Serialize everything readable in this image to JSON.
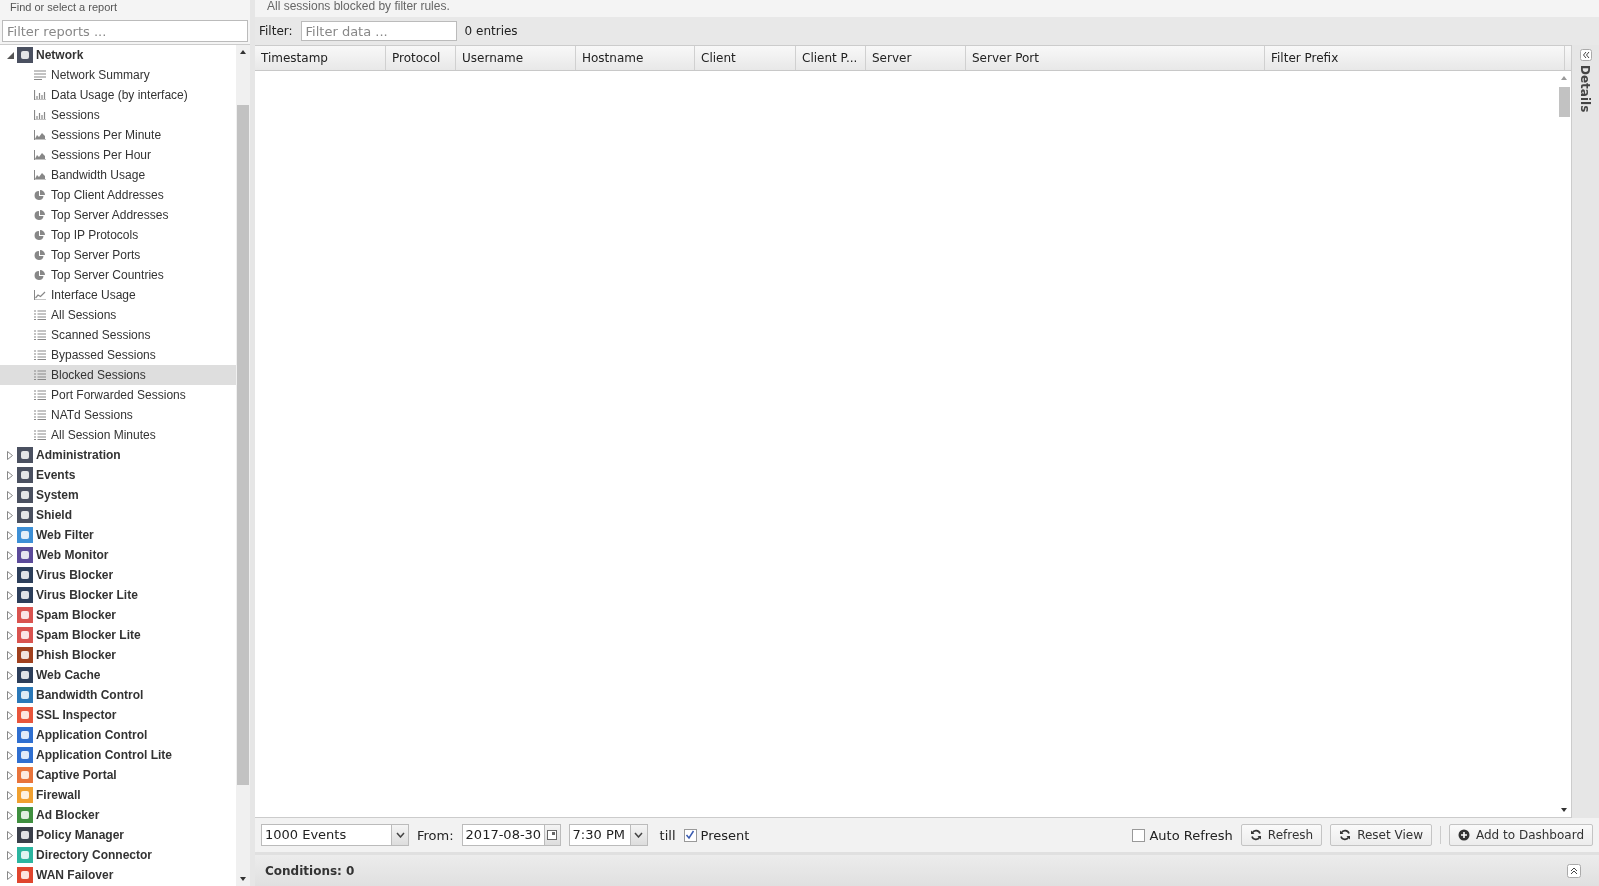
{
  "sidebar": {
    "title": "Find or select a report",
    "search": {
      "placeholder": "Filter reports ..."
    },
    "tree": [
      {
        "label": "Network",
        "color": "#4a5060",
        "expanded": true,
        "children": [
          {
            "label": "Network Summary",
            "kind": "summary",
            "selected": false
          },
          {
            "label": "Data Usage (by interface)",
            "kind": "bar",
            "selected": false
          },
          {
            "label": "Sessions",
            "kind": "bar",
            "selected": false
          },
          {
            "label": "Sessions Per Minute",
            "kind": "area",
            "selected": false
          },
          {
            "label": "Sessions Per Hour",
            "kind": "area",
            "selected": false
          },
          {
            "label": "Bandwidth Usage",
            "kind": "area",
            "selected": false
          },
          {
            "label": "Top Client Addresses",
            "kind": "pie",
            "selected": false
          },
          {
            "label": "Top Server Addresses",
            "kind": "pie",
            "selected": false
          },
          {
            "label": "Top IP Protocols",
            "kind": "pie",
            "selected": false
          },
          {
            "label": "Top Server Ports",
            "kind": "pie",
            "selected": false
          },
          {
            "label": "Top Server Countries",
            "kind": "pie",
            "selected": false
          },
          {
            "label": "Interface Usage",
            "kind": "line",
            "selected": false
          },
          {
            "label": "All Sessions",
            "kind": "list",
            "selected": false
          },
          {
            "label": "Scanned Sessions",
            "kind": "list",
            "selected": false
          },
          {
            "label": "Bypassed Sessions",
            "kind": "list",
            "selected": false
          },
          {
            "label": "Blocked Sessions",
            "kind": "list",
            "selected": true
          },
          {
            "label": "Port Forwarded Sessions",
            "kind": "list",
            "selected": false
          },
          {
            "label": "NATd Sessions",
            "kind": "list",
            "selected": false
          },
          {
            "label": "All Session Minutes",
            "kind": "list",
            "selected": false
          }
        ]
      },
      {
        "label": "Administration",
        "color": "#4a5060",
        "expanded": false
      },
      {
        "label": "Events",
        "color": "#4a5060",
        "expanded": false
      },
      {
        "label": "System",
        "color": "#4a5060",
        "expanded": false
      },
      {
        "label": "Shield",
        "color": "#4a5060",
        "expanded": false
      },
      {
        "label": "Web Filter",
        "color": "#3d8fd6",
        "expanded": false
      },
      {
        "label": "Web Monitor",
        "color": "#5b4a9a",
        "expanded": false
      },
      {
        "label": "Virus Blocker",
        "color": "#2c3e5a",
        "expanded": false
      },
      {
        "label": "Virus Blocker Lite",
        "color": "#2c3e5a",
        "expanded": false
      },
      {
        "label": "Spam Blocker",
        "color": "#d9534f",
        "expanded": false
      },
      {
        "label": "Spam Blocker Lite",
        "color": "#d9534f",
        "expanded": false
      },
      {
        "label": "Phish Blocker",
        "color": "#a0401e",
        "expanded": false
      },
      {
        "label": "Web Cache",
        "color": "#2c3e5a",
        "expanded": false
      },
      {
        "label": "Bandwidth Control",
        "color": "#2a78b8",
        "expanded": false
      },
      {
        "label": "SSL Inspector",
        "color": "#e8553b",
        "expanded": false
      },
      {
        "label": "Application Control",
        "color": "#2f6fd0",
        "expanded": false
      },
      {
        "label": "Application Control Lite",
        "color": "#2f6fd0",
        "expanded": false
      },
      {
        "label": "Captive Portal",
        "color": "#e8743b",
        "expanded": false
      },
      {
        "label": "Firewall",
        "color": "#f0a030",
        "expanded": false
      },
      {
        "label": "Ad Blocker",
        "color": "#3f8f3f",
        "expanded": false
      },
      {
        "label": "Policy Manager",
        "color": "#3a3f4a",
        "expanded": false
      },
      {
        "label": "Directory Connector",
        "color": "#2bb5a0",
        "expanded": false
      },
      {
        "label": "WAN Failover",
        "color": "#e0452e",
        "expanded": false
      }
    ]
  },
  "report": {
    "description": "All sessions blocked by filter rules.",
    "filter": {
      "label": "Filter:",
      "placeholder": "Filter data ...",
      "count": "0 entries"
    },
    "table": {
      "columns": [
        "Timestamp",
        "Protocol",
        "Username",
        "Hostname",
        "Client",
        "Client P...",
        "Server",
        "Server Port",
        "Filter Prefix"
      ]
    },
    "toolbar": {
      "limit": "1000 Events",
      "from_label": "From:",
      "date": "2017-08-30",
      "time": "7:30 PM",
      "till_label": "till",
      "present": {
        "label": "Present",
        "checked": true
      },
      "auto_refresh": {
        "label": "Auto Refresh",
        "checked": false
      },
      "buttons": [
        {
          "label": "Refresh",
          "kind": "refresh"
        },
        {
          "label": "Reset View",
          "kind": "refresh"
        },
        {
          "label": "Add to Dashboard",
          "kind": "add"
        }
      ]
    },
    "conditions": "Conditions: 0"
  },
  "details_tab": "Details"
}
